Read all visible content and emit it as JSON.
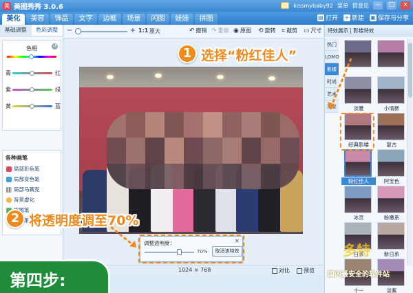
{
  "app": {
    "title": "美图秀秀 3.0.6",
    "account": "kissmybaby92",
    "menu_label": "菜单",
    "feedback_label": "提意见",
    "window_min": "—",
    "window_max": "□",
    "window_close": "×"
  },
  "main_tabs": [
    {
      "label": "美化",
      "active": true
    },
    {
      "label": "美容",
      "active": false
    },
    {
      "label": "饰品",
      "active": false
    },
    {
      "label": "文字",
      "active": false
    },
    {
      "label": "边框",
      "active": false
    },
    {
      "label": "场景",
      "active": false
    },
    {
      "label": "闪图",
      "active": false
    },
    {
      "label": "娃娃",
      "active": false
    },
    {
      "label": "拼图",
      "active": false
    }
  ],
  "top_actions": {
    "open": "打开",
    "new": "新建",
    "save_share": "保存与分享"
  },
  "left_panel": {
    "tabs": [
      "基础调整",
      "色彩调整"
    ],
    "hue_label": "色相",
    "rows": [
      {
        "left": "青",
        "right": "红",
        "value": 0.5
      },
      {
        "left": "紫",
        "right": "绿",
        "value": 0.5
      },
      {
        "left": "黄",
        "right": "蓝",
        "value": 0.5
      }
    ],
    "hue_value": 0.5,
    "brush_title": "各种画笔",
    "brushes": [
      "局部彩色笔",
      "局部变色笔",
      "局部马赛克",
      "背景虚化",
      "抠图笔",
      "涂鸦笔"
    ]
  },
  "toolbar": {
    "minus": "−",
    "plus": "+",
    "zoom_ratio": "1:1",
    "original_size": "原大",
    "undo": "撤销",
    "redo": "重做",
    "original": "原图",
    "rotate": "旋转",
    "crop": "裁剪",
    "resize": "尺寸",
    "zoom_level": 0.05
  },
  "opacity_dialog": {
    "label": "调整透明度：",
    "value_text": "70%",
    "value": 0.7,
    "cancel_button": "取消该特效",
    "close": "×"
  },
  "statusbar": {
    "dimensions": "1024  ×  768",
    "compare": "对比",
    "preview": "预览"
  },
  "right_panel": {
    "header": "特效展示 | 影楼特效",
    "categories": [
      {
        "label": "热门",
        "active": false
      },
      {
        "label": "LOMO",
        "active": false
      },
      {
        "label": "影楼",
        "active": true
      },
      {
        "label": "时尚",
        "active": false
      },
      {
        "label": "艺术",
        "active": false
      },
      {
        "label": "渐变",
        "active": false
      }
    ],
    "effects": [
      {
        "label": "",
        "tint": "#6c6a88"
      },
      {
        "label": "",
        "tint": "#b57ea9"
      },
      {
        "label": "淡雅",
        "tint": "#8f8fa8"
      },
      {
        "label": "小清新",
        "tint": "#9fb4c9"
      },
      {
        "label": "经典影楼",
        "tint": "#b0787f"
      },
      {
        "label": "复古",
        "tint": "#9b7056"
      },
      {
        "label": "粉红佳人",
        "tint": "#c98aa8",
        "selected": true
      },
      {
        "label": "阿宝色",
        "tint": "#8aa6b8"
      },
      {
        "label": "冰灵",
        "tint": "#7f9cc4"
      },
      {
        "label": "粉嫩系",
        "tint": "#d797b7"
      },
      {
        "label": "日系",
        "tint": "#a9b3b8"
      },
      {
        "label": "新日系",
        "tint": "#b8a6a0"
      },
      {
        "label": "十一",
        "tint": "#9c8570"
      },
      {
        "label": "淡紫",
        "tint": "#a58ab8"
      }
    ]
  },
  "tutorial": {
    "step1_number": "1",
    "step1_text": "选择“粉红佳人”",
    "step2_number": "2",
    "step2_text": "将透明度调至70%",
    "step_banner": "第四步:",
    "watermark_logo": "多特",
    "watermark": "国内最安全的软件站"
  },
  "colors": {
    "accent_orange": "#f08a1c",
    "step_green": "#1f8c3a",
    "app_blue": "#3d88d4"
  }
}
